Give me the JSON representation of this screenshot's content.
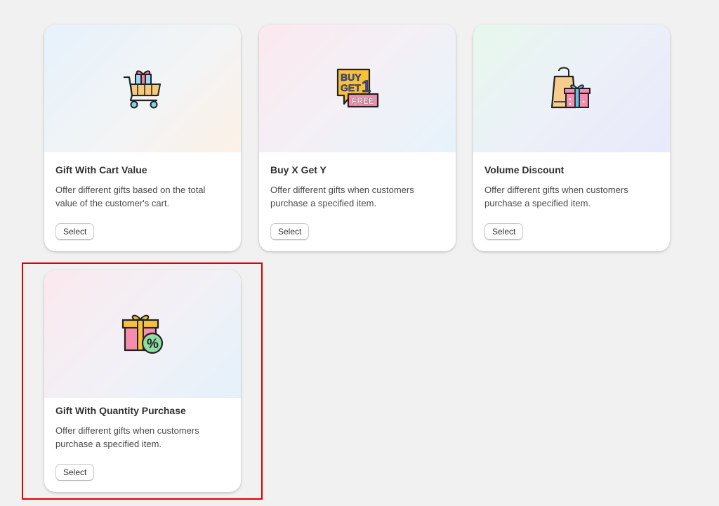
{
  "cards": [
    {
      "title": "Gift With Cart Value",
      "description": "Offer different gifts based on the total value of the customer's cart.",
      "button_label": "Select",
      "icon": "cart-gift-icon"
    },
    {
      "title": "Buy X Get Y",
      "description": "Offer different gifts when customers purchase a specified item.",
      "button_label": "Select",
      "icon": "buy-get-free-icon",
      "icon_text": {
        "line1": "BUY",
        "line2": "GET",
        "number": "1",
        "badge": "FREE"
      }
    },
    {
      "title": "Volume Discount",
      "description": "Offer different gifts when customers purchase a specified item.",
      "button_label": "Select",
      "icon": "shopping-bag-gift-icon"
    },
    {
      "title": "Gift With Quantity Purchase",
      "description": "Offer different gifts when customers purchase a specified item.",
      "button_label": "Select",
      "icon": "gift-percent-icon",
      "icon_text": {
        "symbol": "%"
      }
    }
  ],
  "colors": {
    "page_background": "#f1f1f1",
    "highlight_border": "#e00000"
  }
}
